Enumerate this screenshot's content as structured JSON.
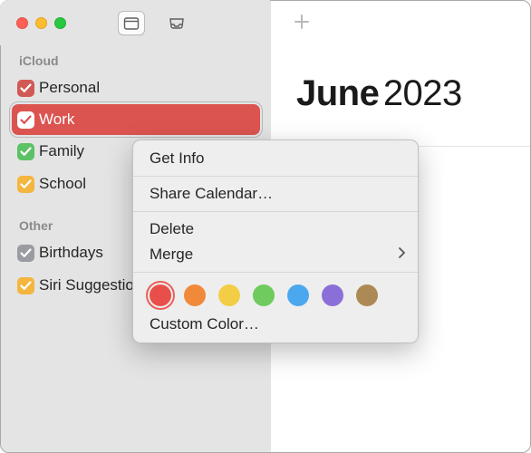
{
  "sidebar": {
    "sections": [
      {
        "title": "iCloud",
        "items": [
          {
            "label": "Personal",
            "color": "#d15a56",
            "checked": true,
            "selected": false
          },
          {
            "label": "Work",
            "color": "#dc5450",
            "checked": true,
            "selected": true
          },
          {
            "label": "Family",
            "color": "#5cc265",
            "checked": true,
            "selected": false
          },
          {
            "label": "School",
            "color": "#f4b63f",
            "checked": true,
            "selected": false
          }
        ]
      },
      {
        "title": "Other",
        "items": [
          {
            "label": "Birthdays",
            "color": "#9b9ba3",
            "checked": true,
            "selected": false
          },
          {
            "label": "Siri Suggestions",
            "color": "#f4b63f",
            "checked": true,
            "selected": false
          }
        ]
      }
    ]
  },
  "main": {
    "month": "June",
    "year": "2023"
  },
  "context_menu": {
    "get_info": "Get Info",
    "share": "Share Calendar…",
    "delete": "Delete",
    "merge": "Merge",
    "custom_color": "Custom Color…",
    "colors": [
      {
        "hex": "#e94f4a",
        "selected": true
      },
      {
        "hex": "#f0893a",
        "selected": false
      },
      {
        "hex": "#f3cd46",
        "selected": false
      },
      {
        "hex": "#6fcb5d",
        "selected": false
      },
      {
        "hex": "#4ba8ef",
        "selected": false
      },
      {
        "hex": "#8b6fd9",
        "selected": false
      },
      {
        "hex": "#ad8a55",
        "selected": false
      }
    ]
  }
}
